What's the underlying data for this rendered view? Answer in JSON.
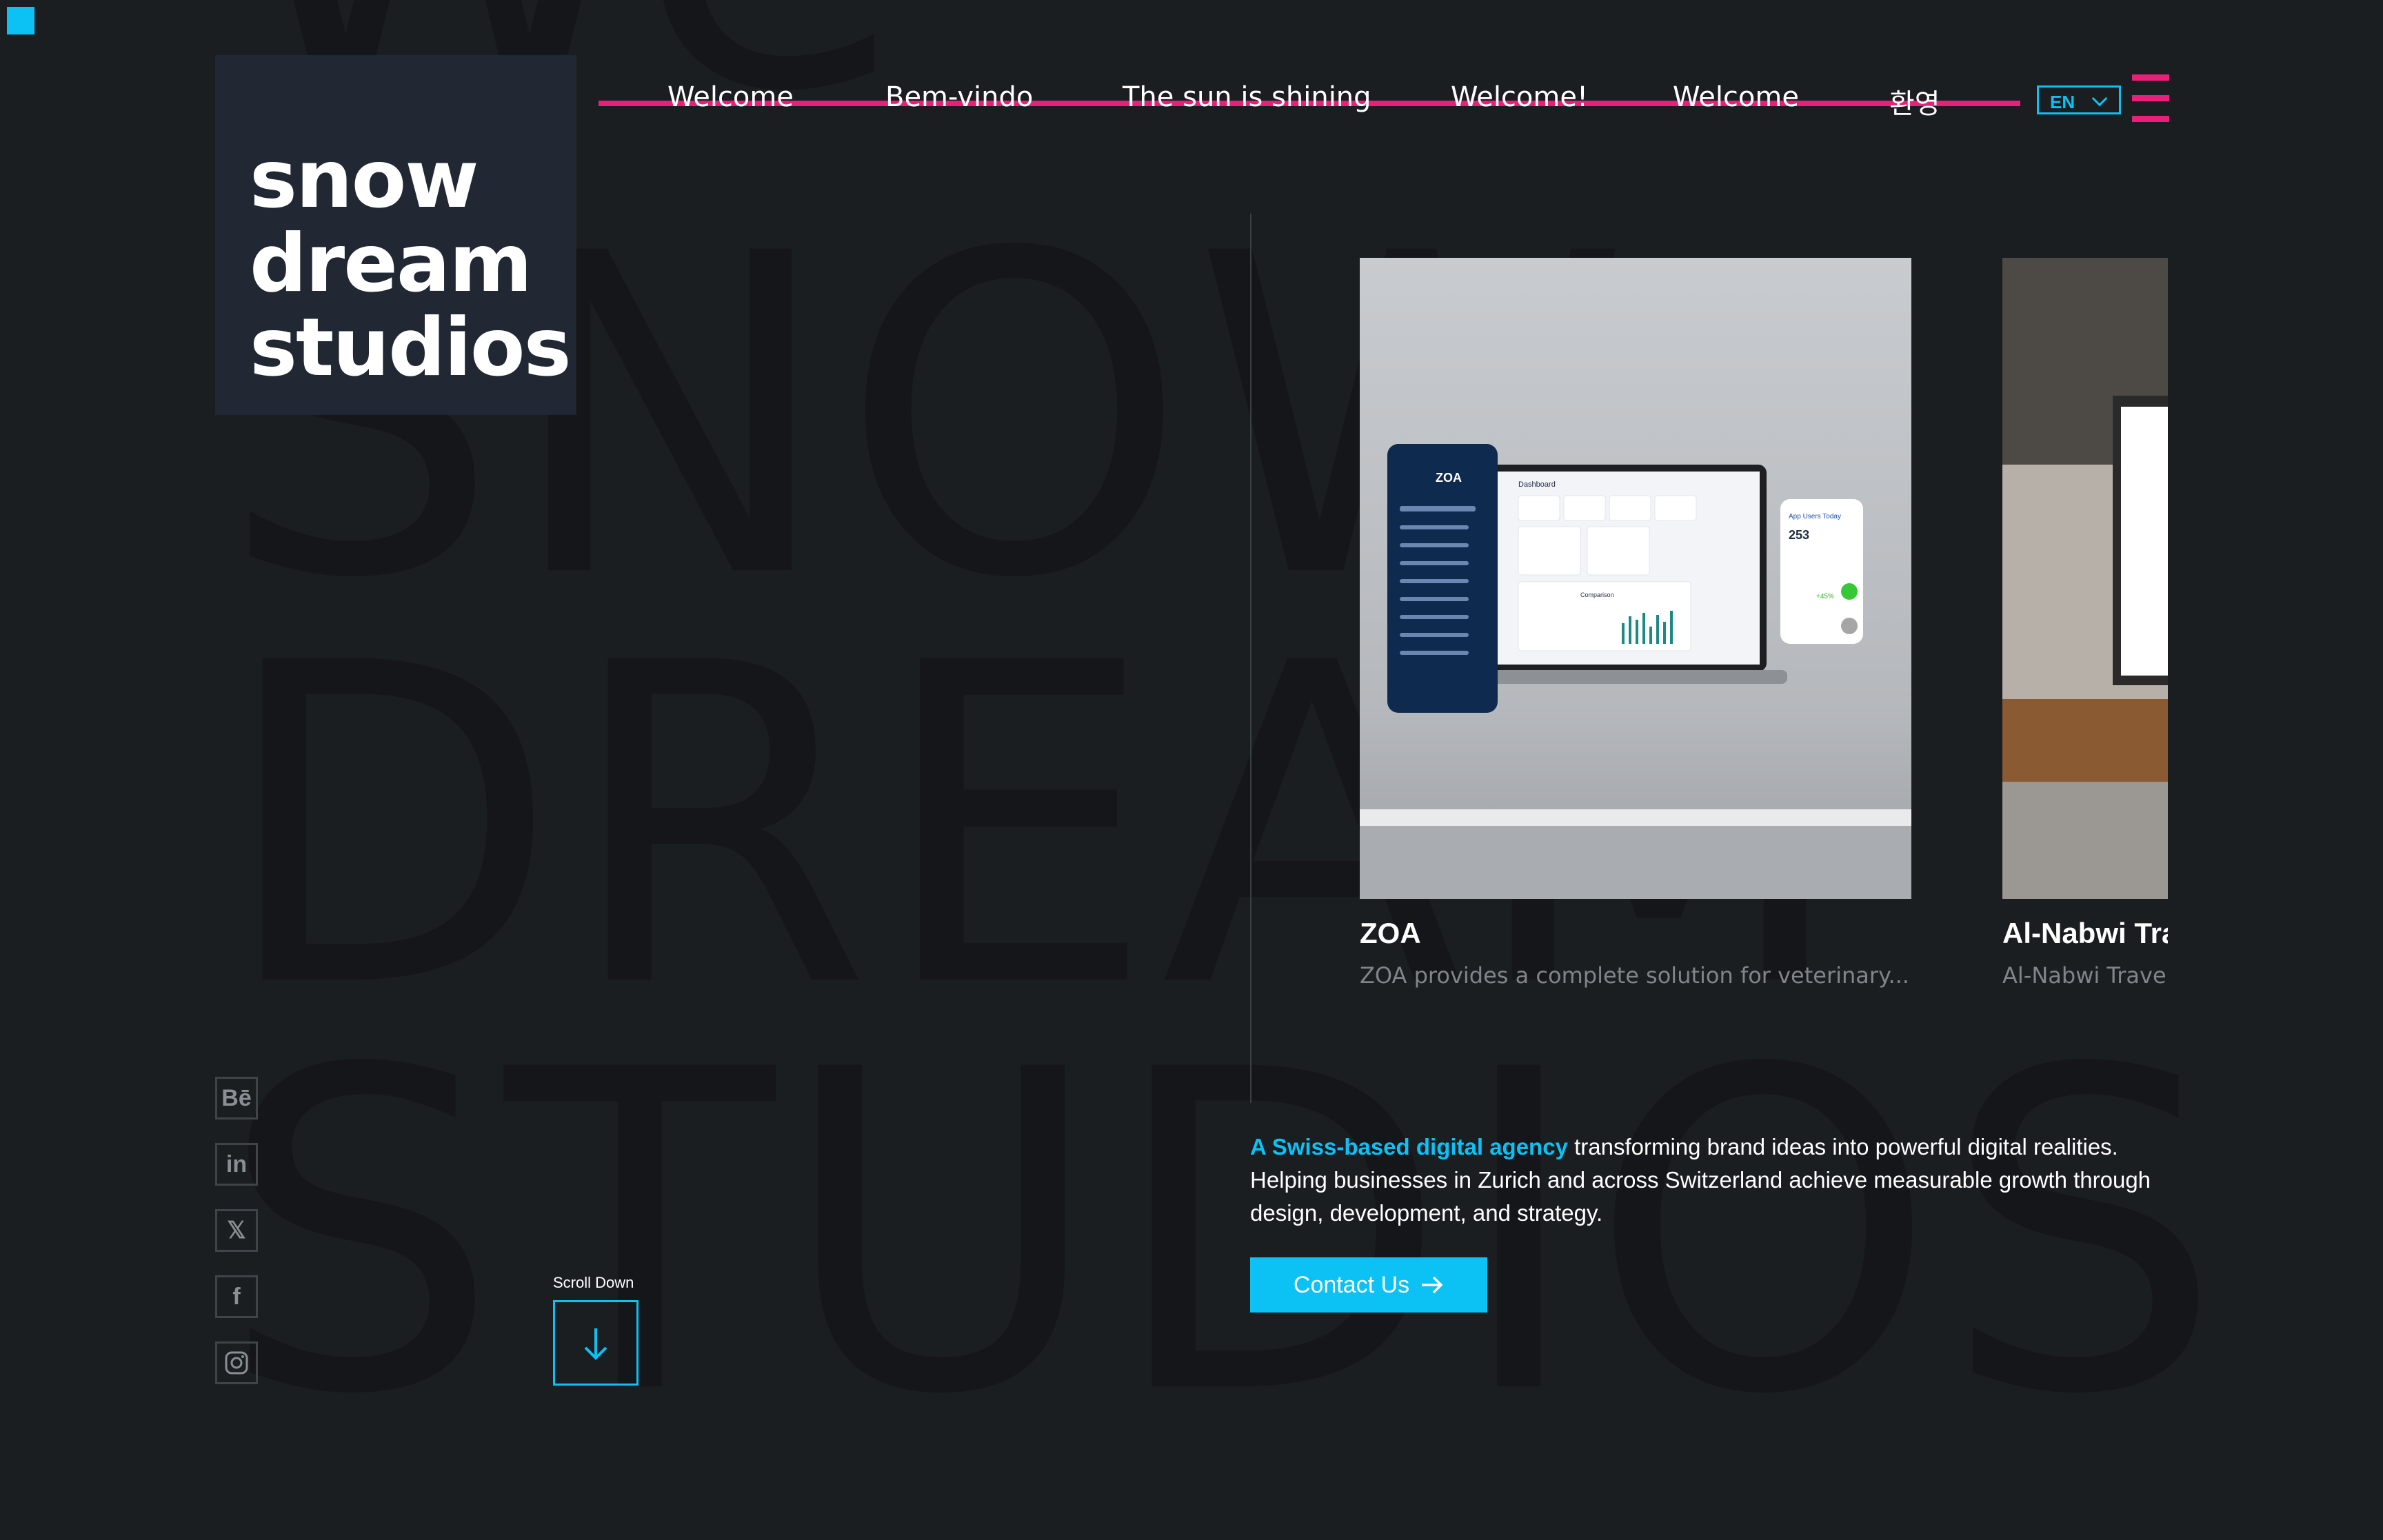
{
  "brand": {
    "logo_lines": [
      "snow",
      "dream",
      "studios"
    ],
    "bg_lines": [
      "We",
      "SNOW",
      "DREAM",
      "STUDIOS"
    ]
  },
  "nav": {
    "items": [
      "Welcome",
      "Bem-vindo",
      "The sun is shining",
      "Welcome!",
      "Welcome",
      "환영"
    ]
  },
  "language": {
    "selected": "EN"
  },
  "projects": [
    {
      "title": "ZOA",
      "description": "ZOA provides a complete solution for veterinary..."
    },
    {
      "title": "Al-Nabwi Tra",
      "description": "Al-Nabwi Trave"
    }
  ],
  "mockup": {
    "brand": "ZOA",
    "dashboard_title": "Dashboard",
    "widget_title": "App Users Today",
    "widget_value": "253",
    "widget_change": "+45%",
    "section_label": "Comparison"
  },
  "about": {
    "highlight": "A Swiss-based digital agency",
    "text": " transforming brand ideas into powerful digital realities. Helping businesses in Zurich and across Switzerland achieve measurable growth through design, development, and strategy."
  },
  "cta": {
    "label": "Contact Us"
  },
  "scroll": {
    "label": "Scroll Down"
  },
  "social": [
    {
      "name": "behance-icon",
      "glyph": "Bē"
    },
    {
      "name": "linkedin-icon",
      "glyph": "in"
    },
    {
      "name": "x-icon",
      "glyph": "𝕏"
    },
    {
      "name": "facebook-icon",
      "glyph": "f"
    },
    {
      "name": "instagram-icon",
      "glyph": ""
    }
  ],
  "colors": {
    "accent": "#0cc1f4",
    "nav_line": "#e8207a",
    "background": "#1b1e21"
  }
}
